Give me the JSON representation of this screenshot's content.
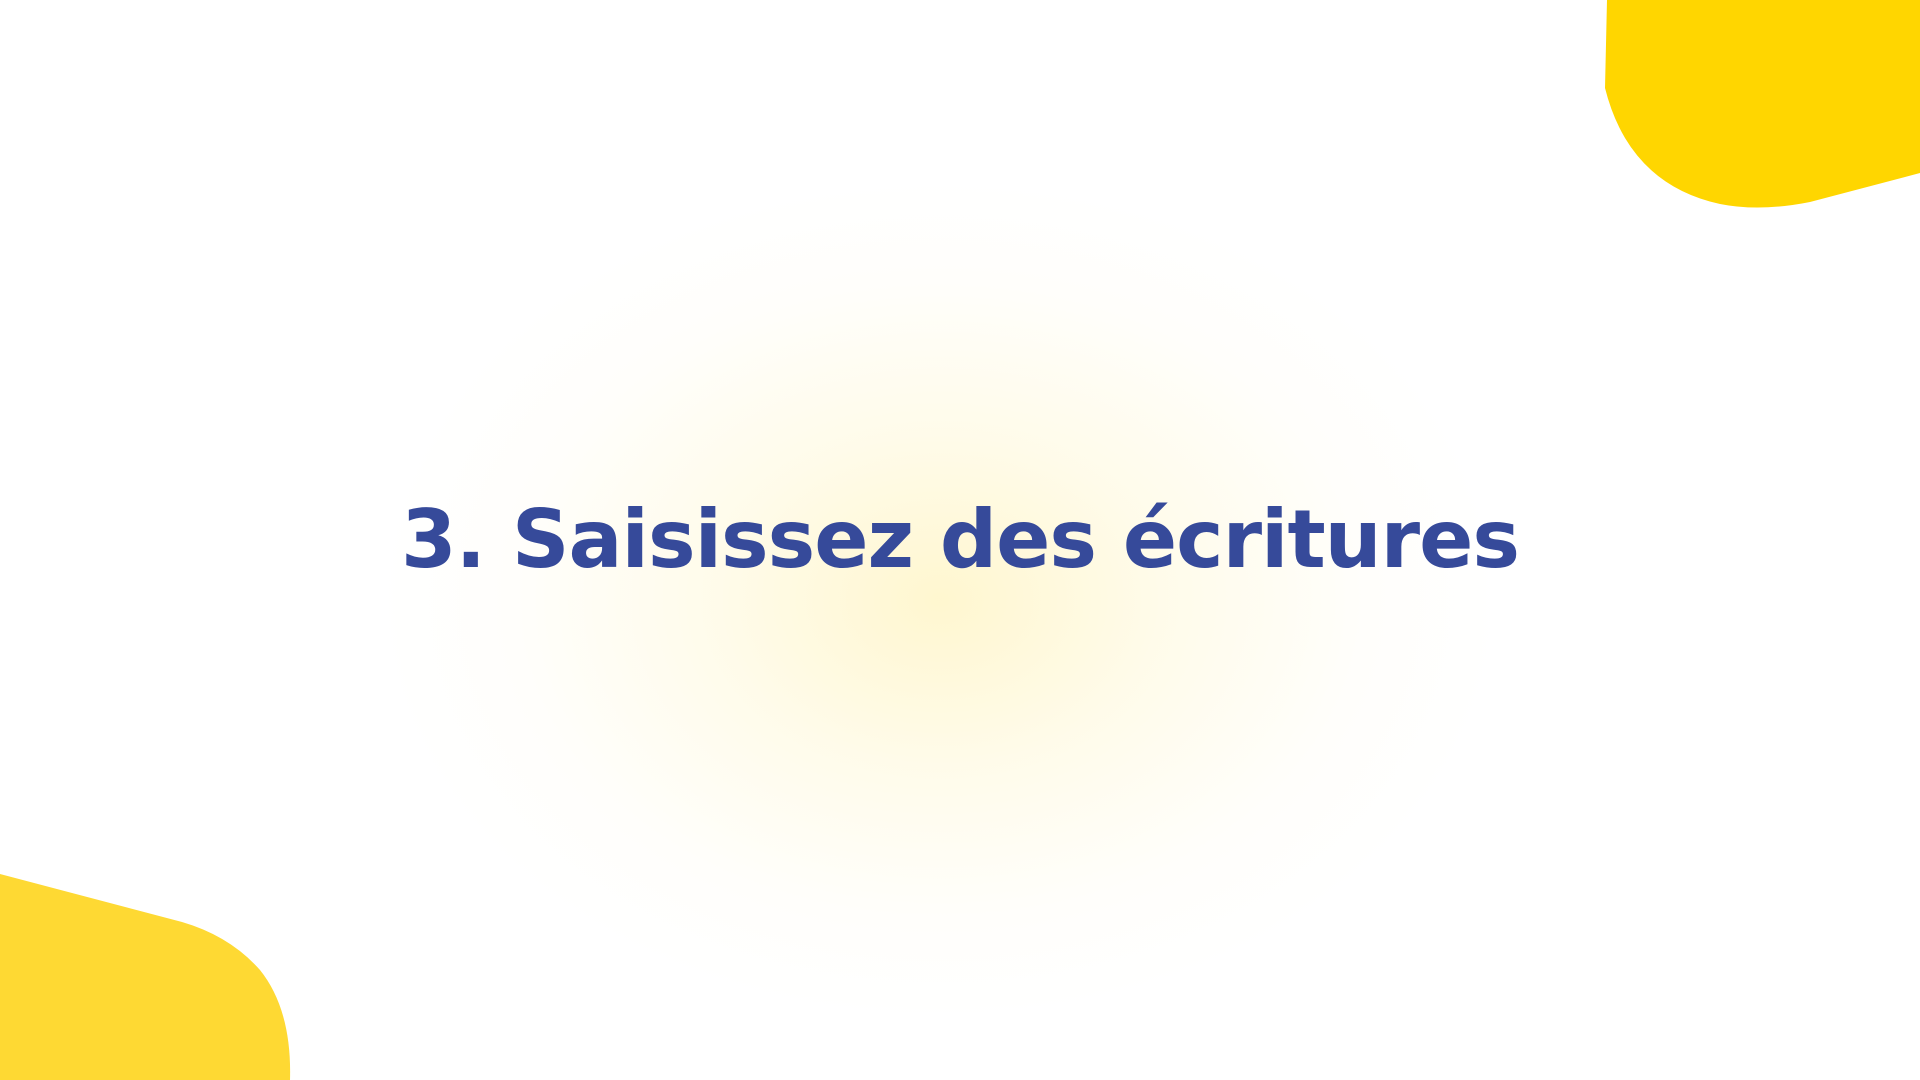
{
  "slide": {
    "title": "3. Saisissez des écritures"
  },
  "colors": {
    "title": "#364a9a",
    "accent_top": "#ffd600",
    "accent_bottom": "#fed933",
    "glow": "#fff3b0",
    "background": "#ffffff"
  },
  "decorations": {
    "top_right": "yellow-rounded-shape",
    "bottom_left": "yellow-rounded-shape"
  }
}
